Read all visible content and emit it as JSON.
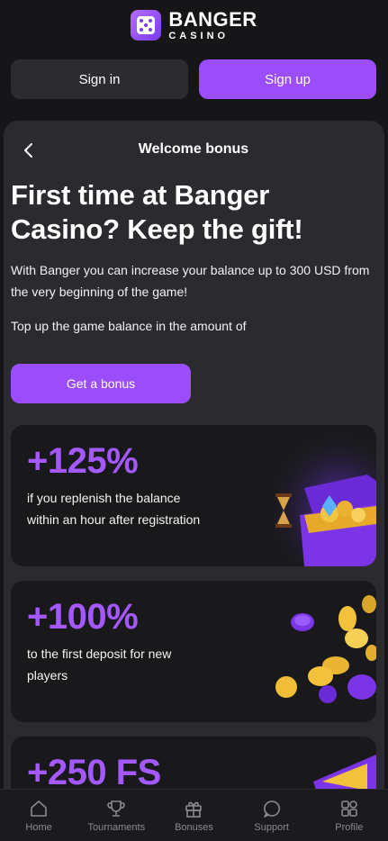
{
  "brand": {
    "line1": "BANGER",
    "line2": "CASINO"
  },
  "auth": {
    "signin_label": "Sign in",
    "signup_label": "Sign up"
  },
  "panel": {
    "title": "Welcome bonus",
    "headline": "First time at Banger Casino? Keep the gift!",
    "description": "With Banger you can increase your balance up to 300 USD from the very beginning of the game!",
    "topup_text": "Top up the game balance in the amount of",
    "cta_label": "Get a bonus"
  },
  "bonuses": [
    {
      "percent": "+125%",
      "text": "if you replenish the balance within an hour after registration"
    },
    {
      "percent": "+100%",
      "text": "to the first deposit for new players"
    },
    {
      "percent": "+250 FS",
      "text": ""
    }
  ],
  "tabbar": [
    {
      "label": "Home",
      "icon": "home-icon"
    },
    {
      "label": "Tournaments",
      "icon": "trophy-icon"
    },
    {
      "label": "Bonuses",
      "icon": "gift-icon"
    },
    {
      "label": "Support",
      "icon": "chat-icon"
    },
    {
      "label": "Profile",
      "icon": "grid-icon"
    }
  ],
  "colors": {
    "accent": "#9b4dfb",
    "background": "#161618",
    "panel": "#2b2b2f",
    "card": "#19191b"
  }
}
